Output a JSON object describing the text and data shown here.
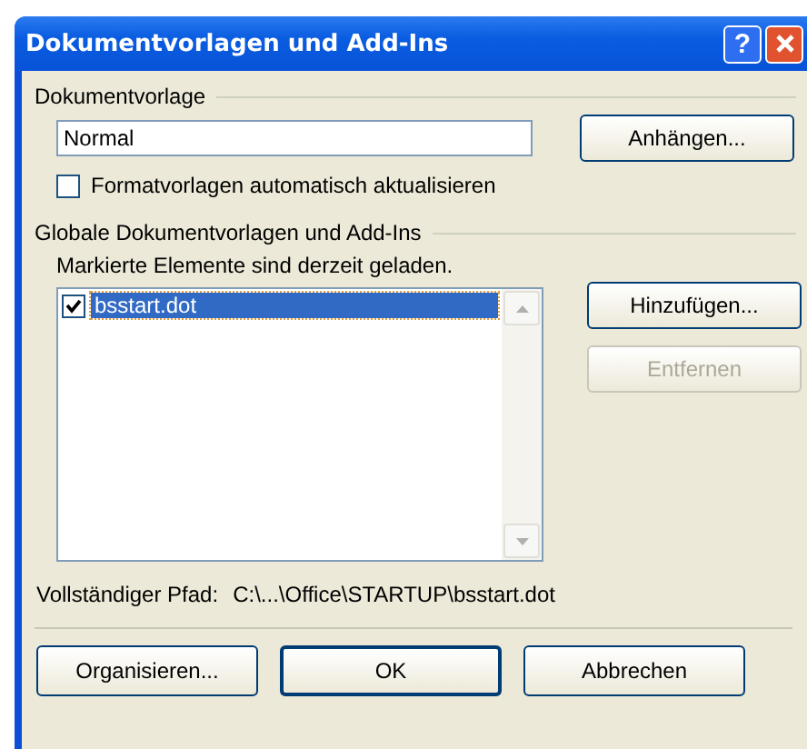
{
  "window": {
    "title": "Dokumentvorlagen und Add-Ins",
    "help_button": "?"
  },
  "template_group": {
    "label": "Dokumentvorlage",
    "field_value": "Normal",
    "attach_button": "Anhängen...",
    "auto_update": {
      "label": "Formatvorlagen automatisch aktualisieren",
      "checked": false
    }
  },
  "global_group": {
    "label": "Globale Dokumentvorlagen und Add-Ins",
    "note": "Markierte Elemente sind derzeit geladen.",
    "items": [
      {
        "name": "bsstart.dot",
        "checked": true,
        "selected": true
      }
    ],
    "add_button": {
      "label": "Hinzufügen...",
      "disabled": false
    },
    "remove_button": {
      "label": "Entfernen",
      "disabled": true
    }
  },
  "path": {
    "label": "Vollständiger Pfad:",
    "value": "C:\\...\\Office\\STARTUP\\bsstart.dot"
  },
  "buttons": [
    {
      "label": "Organisieren...",
      "default": false
    },
    {
      "label": "OK",
      "default": true
    },
    {
      "label": "Abbrechen",
      "default": false
    }
  ]
}
